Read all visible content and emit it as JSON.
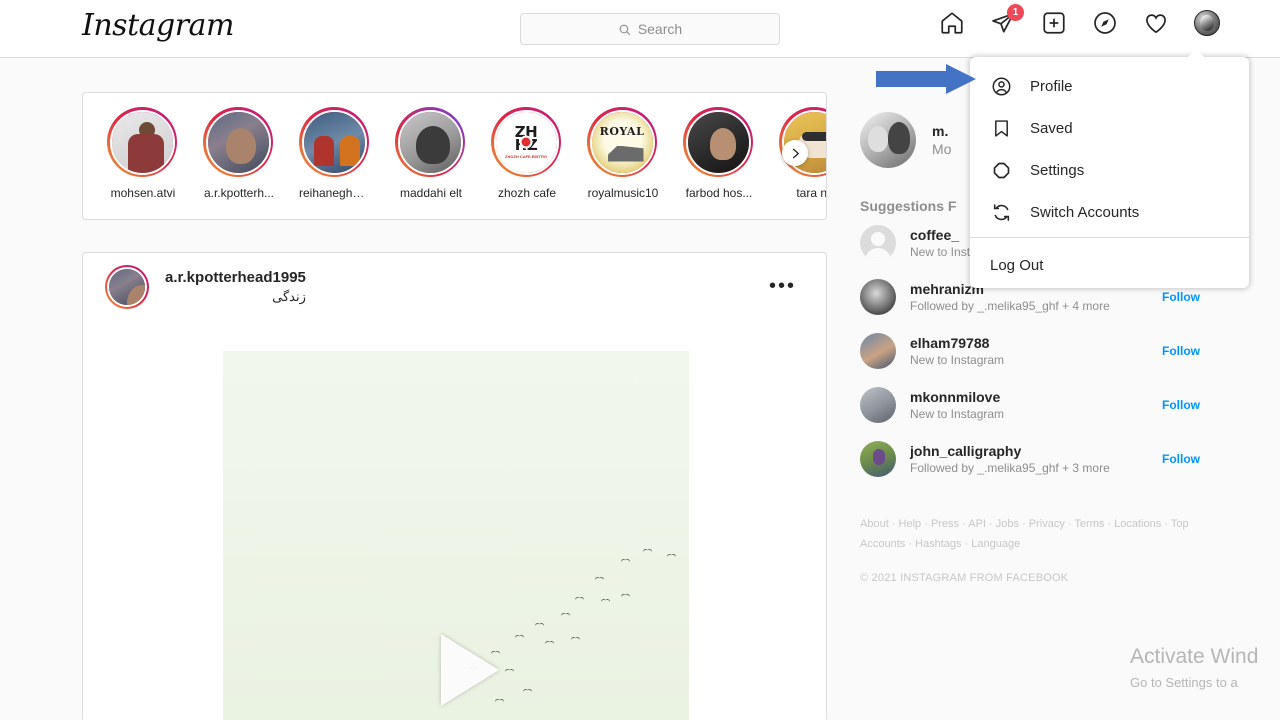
{
  "brand": {
    "name": "Instagram"
  },
  "search": {
    "placeholder": "Search",
    "value": ""
  },
  "nav": {
    "home_label": "Home",
    "messages_label": "Messages",
    "messages_badge": "1",
    "new_post_label": "New Post",
    "explore_label": "Explore",
    "activity_label": "Activity",
    "profile_label": "Profile"
  },
  "dropdown": {
    "items": [
      {
        "label": "Profile",
        "icon": "person-circle-icon"
      },
      {
        "label": "Saved",
        "icon": "bookmark-icon"
      },
      {
        "label": "Settings",
        "icon": "gear-icon"
      },
      {
        "label": "Switch Accounts",
        "icon": "switch-accounts-icon"
      }
    ],
    "logout": {
      "label": "Log Out"
    }
  },
  "annotation": {
    "arrow_color": "#4472C4",
    "points_to": "Profile"
  },
  "stories": {
    "next_label": "›",
    "items": [
      {
        "name": "mohsen.atvi",
        "ring": "gradient"
      },
      {
        "name": "a.r.kpotterh...",
        "ring": "gradient"
      },
      {
        "name": "reihaneghaf...",
        "ring": "gradient"
      },
      {
        "name": "maddahi elt",
        "ring": "purple"
      },
      {
        "name": "zhozh cafe",
        "ring": "gradient"
      },
      {
        "name": "royalmusic10",
        "ring": "gradient"
      },
      {
        "name": "farbod hos...",
        "ring": "gradient"
      },
      {
        "name": "tara ne",
        "ring": "gradient"
      }
    ],
    "logos": {
      "zh_line1": "ZH",
      "zh_line2": "HZ",
      "zh_sub": "ZHOZH CAFE BISTRO",
      "royal": "ROYAL"
    }
  },
  "post": {
    "username": "a.r.kpotterhead1995",
    "location": "زندگی",
    "more_label": "•••",
    "media_type": "video"
  },
  "sidebar": {
    "me": {
      "username": "m.",
      "fullname": "Mo"
    },
    "suggestions_title": "Suggestions F",
    "see_all": "",
    "suggestions": [
      {
        "username": "coffee_",
        "subtitle": "New to Instagram",
        "action": ""
      },
      {
        "username": "mehranizm",
        "subtitle": "Followed by _.melika95_ghf + 4 more",
        "action": "Follow"
      },
      {
        "username": "elham79788",
        "subtitle": "New to Instagram",
        "action": "Follow"
      },
      {
        "username": "mkonnmilove",
        "subtitle": "New to Instagram",
        "action": "Follow"
      },
      {
        "username": "john_calligraphy",
        "subtitle": "Followed by _.melika95_ghf + 3 more",
        "action": "Follow"
      }
    ],
    "footer": {
      "links": [
        "About",
        "Help",
        "Press",
        "API",
        "Jobs",
        "Privacy",
        "Terms",
        "Locations",
        "Top Accounts",
        "Hashtags",
        "Language"
      ],
      "copyright": "© 2021 INSTAGRAM FROM FACEBOOK"
    }
  },
  "watermark": {
    "line1": "Activate Wind",
    "line2": "Go to Settings to a"
  },
  "colors": {
    "accent": "#0095f6",
    "badge": "#ed4956",
    "annotation": "#4472C4",
    "text": "#262626",
    "muted": "#8e8e8e"
  }
}
